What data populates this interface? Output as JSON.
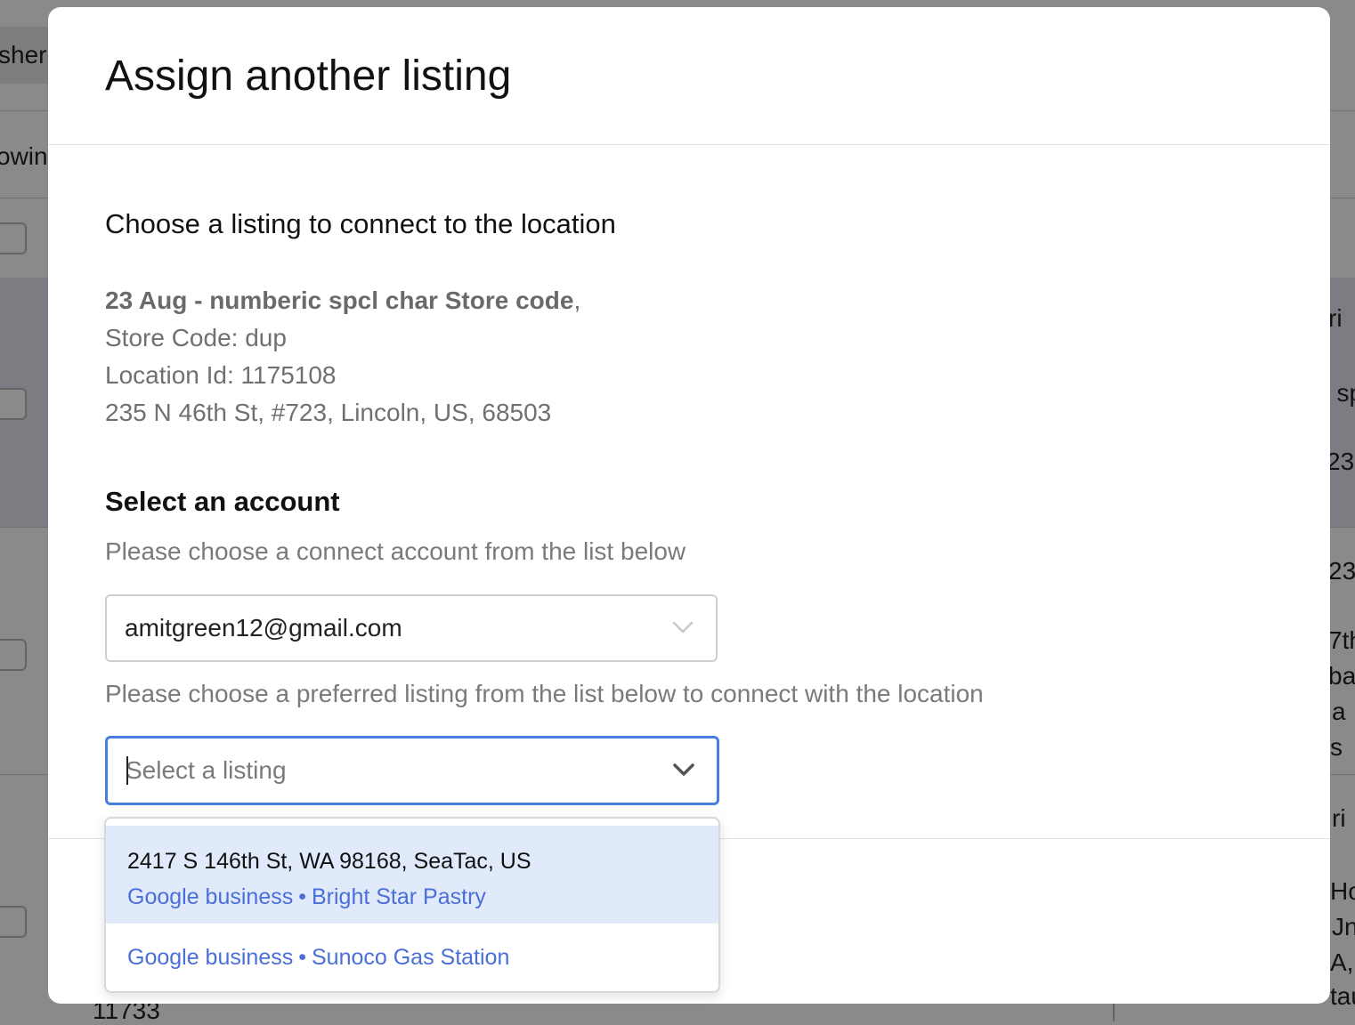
{
  "background": {
    "left_fragments": [
      "sher:",
      "owin"
    ],
    "right_fragments": [
      "ri",
      ": sp",
      "23",
      "23",
      "7th",
      "bac",
      "a",
      "s",
      "ri",
      "Hou",
      "Jnit",
      "A,",
      "tau"
    ],
    "bottom_fragment": "11733"
  },
  "modal": {
    "title": "Assign another listing",
    "section_title": "Choose a listing to connect to the location",
    "location": {
      "name": "23 Aug - numberic spcl char Store code",
      "separator": ",",
      "store_code": "Store Code: dup",
      "location_id": "Location Id: 1175108",
      "address": "235 N 46th St, #723, Lincoln, US, 68503"
    },
    "account": {
      "title": "Select an account",
      "help": "Please choose a connect account from the list below",
      "selected_value": "amitgreen12@gmail.com",
      "icon": "chevron-down-icon"
    },
    "listing": {
      "help": "Please choose a preferred listing from the list below to connect with the location",
      "placeholder": "Select a listing",
      "icon": "chevron-down-icon",
      "focus_color": "#4a7de0"
    },
    "dropdown": {
      "options": [
        {
          "address": "2417 S 146th St, WA 98168, SeaTac, US",
          "source": "Google business",
          "dot": "•",
          "name": "Bright Star Pastry",
          "highlighted": true
        },
        {
          "address": "",
          "source": "Google business",
          "dot": "•",
          "name": "Sunoco Gas Station",
          "highlighted": false
        }
      ],
      "highlight_color": "#e1eafb",
      "link_color": "#4a6fd8"
    }
  }
}
